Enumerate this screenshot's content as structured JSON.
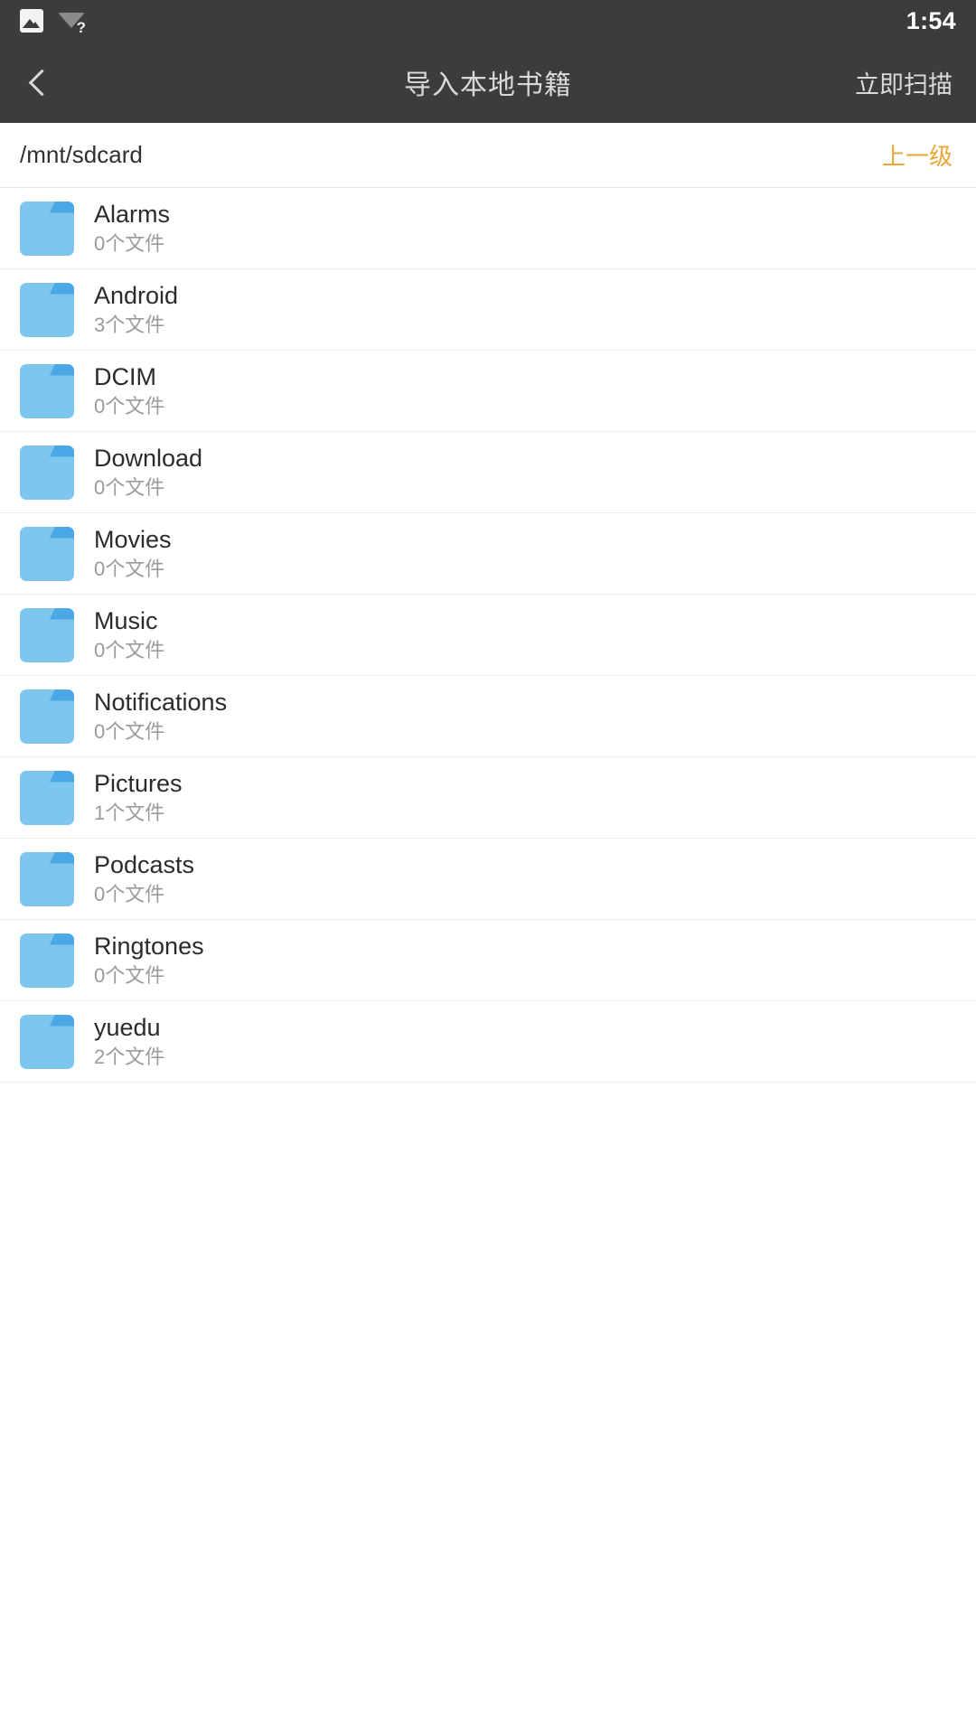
{
  "status_bar": {
    "icons": [
      "gallery-icon",
      "wifi-unknown-icon"
    ],
    "wifi_badge": "?",
    "time": "1:54",
    "background_color": "#3c3c3c"
  },
  "app_bar": {
    "back_icon": "chevron-left-icon",
    "title": "导入本地书籍",
    "action_label": "立即扫描",
    "background_color": "#3c3c3c",
    "text_color": "#d9d9d9"
  },
  "path_bar": {
    "current_path": "/mnt/sdcard",
    "up_level_label": "上一级",
    "up_level_color": "#e8a838"
  },
  "file_list": {
    "folder_icon_color": "#7fc6ee",
    "folder_tab_color": "#4ba8e6",
    "rows": [
      {
        "name": "Alarms",
        "subtitle": "0个文件",
        "icon": "folder-icon"
      },
      {
        "name": "Android",
        "subtitle": "3个文件",
        "icon": "folder-icon"
      },
      {
        "name": "DCIM",
        "subtitle": "0个文件",
        "icon": "folder-icon"
      },
      {
        "name": "Download",
        "subtitle": "0个文件",
        "icon": "folder-icon"
      },
      {
        "name": "Movies",
        "subtitle": "0个文件",
        "icon": "folder-icon"
      },
      {
        "name": "Music",
        "subtitle": "0个文件",
        "icon": "folder-icon"
      },
      {
        "name": "Notifications",
        "subtitle": "0个文件",
        "icon": "folder-icon"
      },
      {
        "name": "Pictures",
        "subtitle": "1个文件",
        "icon": "folder-icon"
      },
      {
        "name": "Podcasts",
        "subtitle": "0个文件",
        "icon": "folder-icon"
      },
      {
        "name": "Ringtones",
        "subtitle": "0个文件",
        "icon": "folder-icon"
      },
      {
        "name": "yuedu",
        "subtitle": "2个文件",
        "icon": "folder-icon"
      }
    ]
  }
}
